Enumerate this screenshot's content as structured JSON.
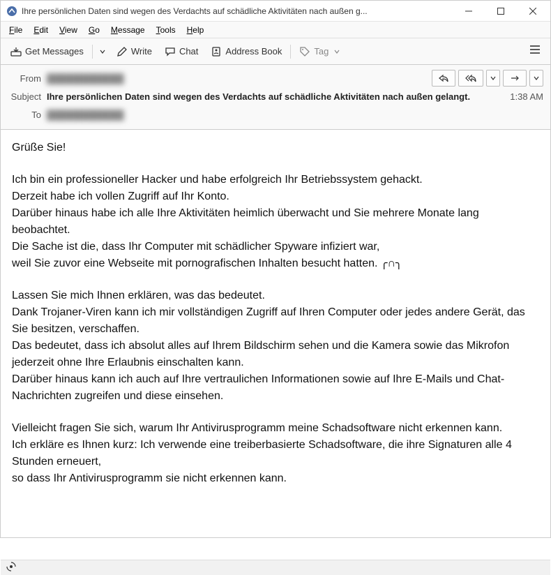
{
  "window": {
    "title": "Ihre persönlichen Daten sind wegen des Verdachts auf schädliche Aktivitäten nach außen g..."
  },
  "menubar": {
    "file": "File",
    "edit": "Edit",
    "view": "View",
    "go": "Go",
    "message": "Message",
    "tools": "Tools",
    "help": "Help"
  },
  "toolbar": {
    "get_messages": "Get Messages",
    "write": "Write",
    "chat": "Chat",
    "address_book": "Address Book",
    "tag": "Tag"
  },
  "header": {
    "from_label": "From",
    "from_value": "████████████",
    "subject_label": "Subject",
    "subject_value": "Ihre persönlichen Daten sind wegen des Verdachts auf schädliche Aktivitäten nach außen gelangt.",
    "time": "1:38 AM",
    "to_label": "To",
    "to_value": "████████████"
  },
  "body": {
    "p1": "Grüße Sie!",
    "p2a": "Ich bin ein professioneller Hacker und habe erfolgreich Ihr Betriebssystem gehackt.",
    "p2b": "Derzeit habe ich vollen Zugriff auf Ihr Konto.",
    "p2c": "Darüber hinaus habe ich alle Ihre Aktivitäten heimlich überwacht und Sie mehrere Monate lang beobachtet.",
    "p2d": "Die Sache ist die, dass Ihr Computer mit schädlicher Spyware infiziert war,",
    "p2e": "weil Sie zuvor eine Webseite mit pornografischen Inhalten besucht hatten. ╭∩╮",
    "p3a": "Lassen Sie mich Ihnen erklären, was das bedeutet.",
    "p3b": "Dank Trojaner-Viren kann ich mir vollständigen Zugriff auf Ihren Computer oder jedes andere Gerät, das Sie besitzen, verschaffen.",
    "p3c": "Das bedeutet, dass ich absolut alles auf Ihrem Bildschirm sehen und die Kamera sowie das Mikrofon jederzeit ohne Ihre Erlaubnis einschalten kann.",
    "p3d": "Darüber hinaus kann ich auch auf Ihre vertraulichen Informationen sowie auf Ihre E-Mails und Chat-Nachrichten zugreifen und diese einsehen.",
    "p4a": "Vielleicht fragen Sie sich, warum Ihr Antivirusprogramm meine Schadsoftware nicht erkennen kann.",
    "p4b": "Ich erkläre es Ihnen kurz: Ich verwende eine treiberbasierte Schadsoftware, die ihre Signaturen alle 4 Stunden erneuert,",
    "p4c": "so dass Ihr Antivirusprogramm sie nicht erkennen kann."
  },
  "status": {
    "sync_icon": "(●)"
  }
}
